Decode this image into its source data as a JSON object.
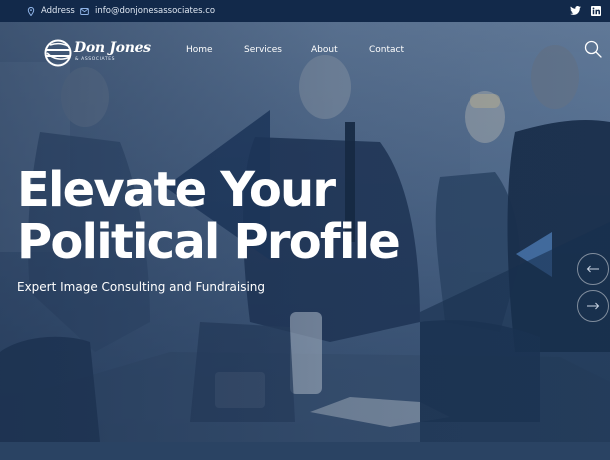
{
  "topbar": {
    "address_label": "Address",
    "email": "info@donjonesassociates.co",
    "icons": {
      "address": "map-pin-icon",
      "email": "envelope-icon",
      "twitter": "twitter-icon",
      "linkedin": "linkedin-icon"
    }
  },
  "header": {
    "logo_text": "Don Jones",
    "logo_subtext": "& ASSOCIATES",
    "nav": [
      "Home",
      "Services",
      "About",
      "Contact"
    ],
    "search_icon": "search-icon"
  },
  "hero": {
    "headline_line1": "Elevate Your",
    "headline_line2": "Political Profile",
    "subheadline": "Expert Image Consulting and Fundraising",
    "prev_icon": "arrow-left-icon",
    "next_icon": "arrow-right-icon"
  },
  "colors": {
    "topbar_bg": "#12294a",
    "hero_overlay": "#1d3658",
    "accent_triangle": "#274a78",
    "text": "#ffffff"
  }
}
